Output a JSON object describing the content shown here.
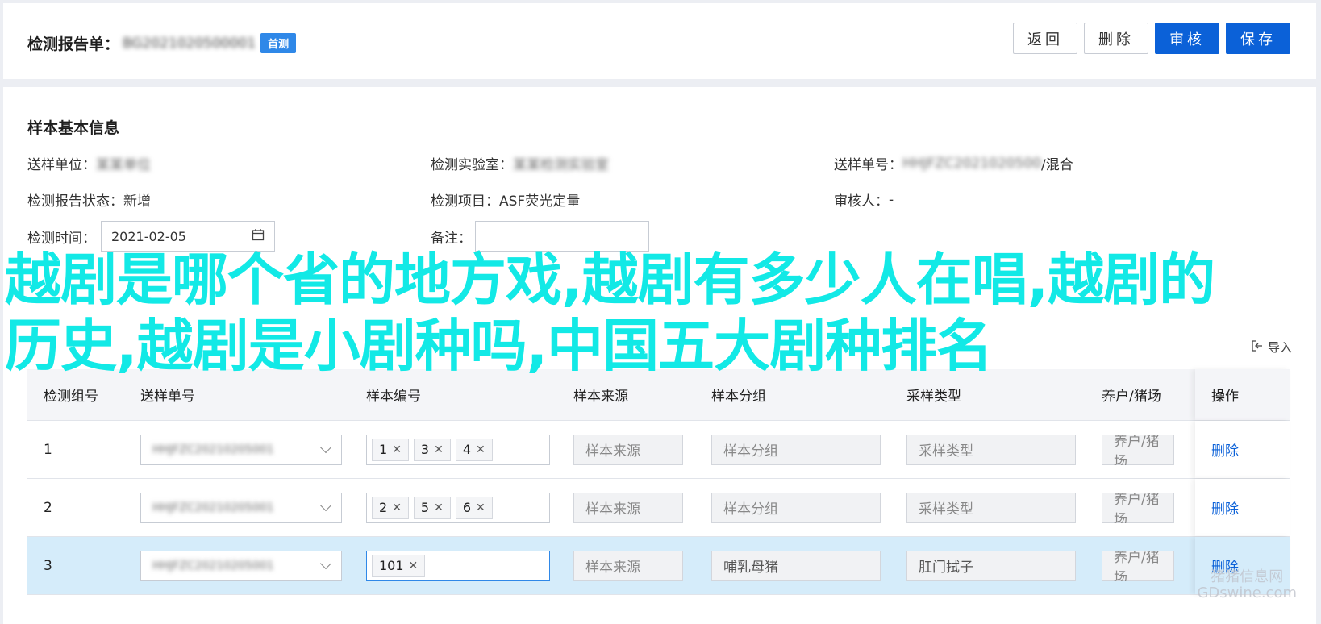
{
  "header": {
    "title_label": "检测报告单：",
    "report_no": "BG2021020500001",
    "first_badge": "首测",
    "buttons": {
      "back": "返回",
      "delete": "删除",
      "review": "审核",
      "save": "保存"
    }
  },
  "sample_info": {
    "section_title": "样本基本信息",
    "fields": {
      "submit_unit_label": "送样单位：",
      "submit_unit_value": "某某单位",
      "lab_label": "检测实验室：",
      "lab_value": "某某检测实验室",
      "submit_no_label": "送样单号：",
      "submit_no_value": "HHJFZC2021020500",
      "submit_no_suffix": "/混合",
      "report_status_label": "检测报告状态：",
      "report_status_value": "新增",
      "project_label": "检测项目：",
      "project_value": "ASF荧光定量",
      "reviewer_label": "审核人：",
      "reviewer_value": "-",
      "time_label": "检测时间：",
      "time_value": "2021-02-05",
      "remark_label": "备注：",
      "remark_value": ""
    }
  },
  "table": {
    "import_label": "导入",
    "columns": [
      "检测组号",
      "送样单号",
      "样本编号",
      "样本来源",
      "样本分组",
      "采样类型",
      "养户/猪场",
      "操作"
    ],
    "rows": [
      {
        "no": "1",
        "submit_no": "HHJFZC20210205001",
        "tags": [
          "1",
          "3",
          "4"
        ],
        "source": "样本来源",
        "group": "样本分组",
        "type": "采样类型",
        "farm": "养户/猪场",
        "action": "删除"
      },
      {
        "no": "2",
        "submit_no": "HHJFZC20210205001",
        "tags": [
          "2",
          "5",
          "6"
        ],
        "source": "样本来源",
        "group": "样本分组",
        "type": "采样类型",
        "farm": "养户/猪场",
        "action": "删除"
      },
      {
        "no": "3",
        "submit_no": "HHJFZC20210205001",
        "tags": [
          "101"
        ],
        "source": "样本来源",
        "group": "哺乳母猪",
        "type": "肛门拭子",
        "farm": "养户/猪场",
        "action": "删除"
      }
    ]
  },
  "overlay_text": "越剧是哪个省的地方戏,越剧有多少人在唱,越剧的历史,越剧是小剧种吗,中国五大剧种排名",
  "watermark": {
    "line1": "猪猪信息网",
    "line2": "GDswine.com"
  },
  "colors": {
    "primary": "#0b61d8",
    "badge": "#2f88e8",
    "overlay": "#12e9e6",
    "selected_row": "#d5ecfa"
  }
}
